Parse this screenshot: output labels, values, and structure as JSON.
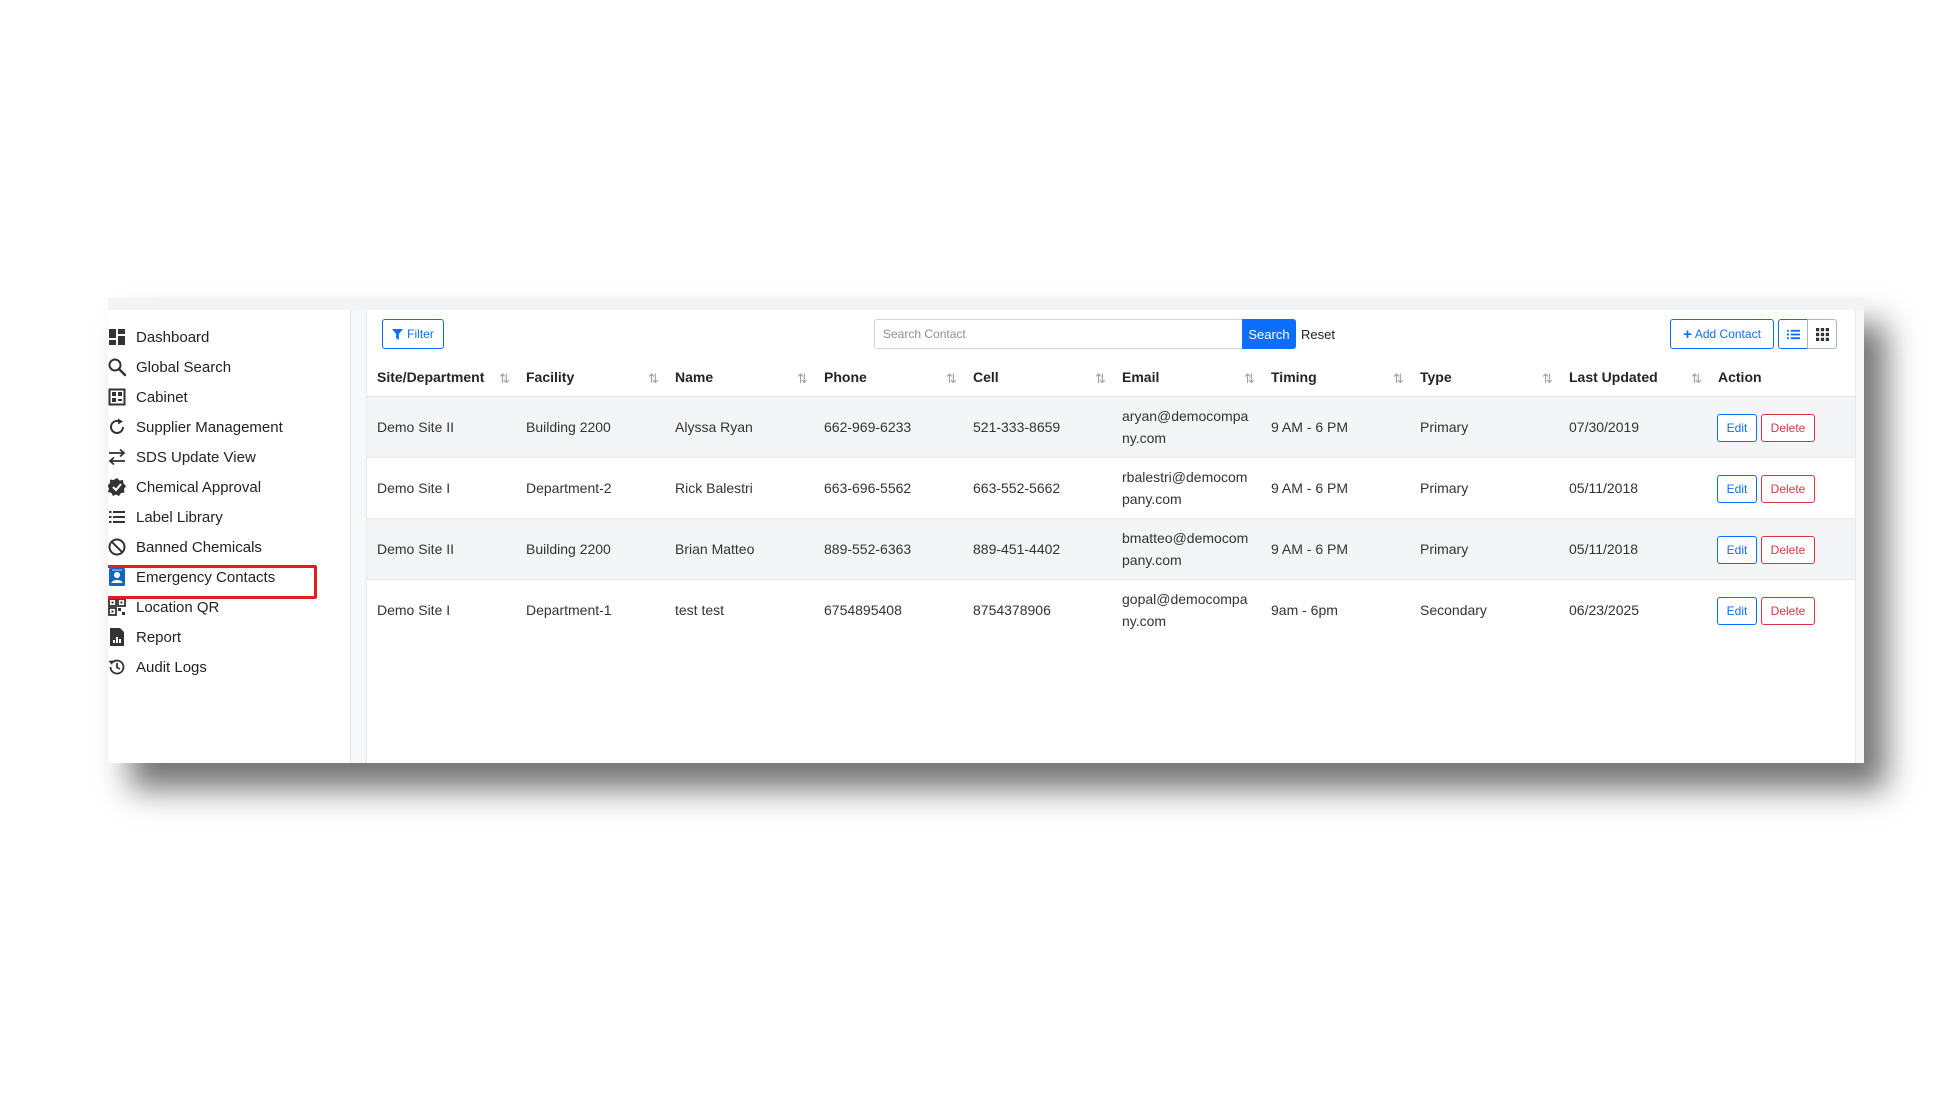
{
  "sidebar": {
    "items": [
      {
        "label": "Dashboard",
        "icon": "dashboard-icon"
      },
      {
        "label": "Global Search",
        "icon": "search-icon"
      },
      {
        "label": "Cabinet",
        "icon": "cabinet-icon"
      },
      {
        "label": "Supplier Management",
        "icon": "refresh-icon"
      },
      {
        "label": "SDS Update View",
        "icon": "swap-arrows-icon"
      },
      {
        "label": "Chemical Approval",
        "icon": "approval-badge-icon"
      },
      {
        "label": "Label Library",
        "icon": "list-icon"
      },
      {
        "label": "Banned Chemicals",
        "icon": "banned-icon"
      },
      {
        "label": "Emergency Contacts",
        "icon": "contact-card-icon"
      },
      {
        "label": "Location QR",
        "icon": "qr-code-icon"
      },
      {
        "label": "Report",
        "icon": "report-icon"
      },
      {
        "label": "Audit Logs",
        "icon": "history-icon"
      }
    ],
    "active": "Emergency Contacts"
  },
  "toolbar": {
    "filter_label": "Filter",
    "search_placeholder": "Search Contact",
    "search_label": "Search",
    "reset_label": "Reset",
    "add_contact_label": "Add Contact"
  },
  "table": {
    "columns": [
      "Site/Department",
      "Facility",
      "Name",
      "Phone",
      "Cell",
      "Email",
      "Timing",
      "Type",
      "Last Updated",
      "Action"
    ],
    "rows": [
      {
        "site": "Demo Site II",
        "facility": "Building 2200",
        "name": "Alyssa Ryan",
        "phone": "662-969-6233",
        "cell": "521-333-8659",
        "email": "aryan@democompany.com",
        "timing": "9 AM - 6 PM",
        "type": "Primary",
        "updated": "07/30/2019"
      },
      {
        "site": "Demo Site I",
        "facility": "Department-2",
        "name": "Rick Balestri",
        "phone": "663-696-5562",
        "cell": "663-552-5662",
        "email": "rbalestri@democompany.com",
        "timing": "9 AM - 6 PM",
        "type": "Primary",
        "updated": "05/11/2018"
      },
      {
        "site": "Demo Site II",
        "facility": "Building 2200",
        "name": "Brian Matteo",
        "phone": "889-552-6363",
        "cell": "889-451-4402",
        "email": "bmatteo@democompany.com",
        "timing": "9 AM - 6 PM",
        "type": "Primary",
        "updated": "05/11/2018"
      },
      {
        "site": "Demo Site I",
        "facility": "Department-1",
        "name": "test test",
        "phone": "6754895408",
        "cell": "8754378906",
        "email": "gopal@democompany.com",
        "timing": "9am - 6pm",
        "type": "Secondary",
        "updated": "06/23/2025"
      }
    ],
    "edit_label": "Edit",
    "delete_label": "Delete"
  },
  "colors": {
    "primary": "#0d6efd",
    "danger": "#dc3545",
    "highlight": "#e02020"
  }
}
